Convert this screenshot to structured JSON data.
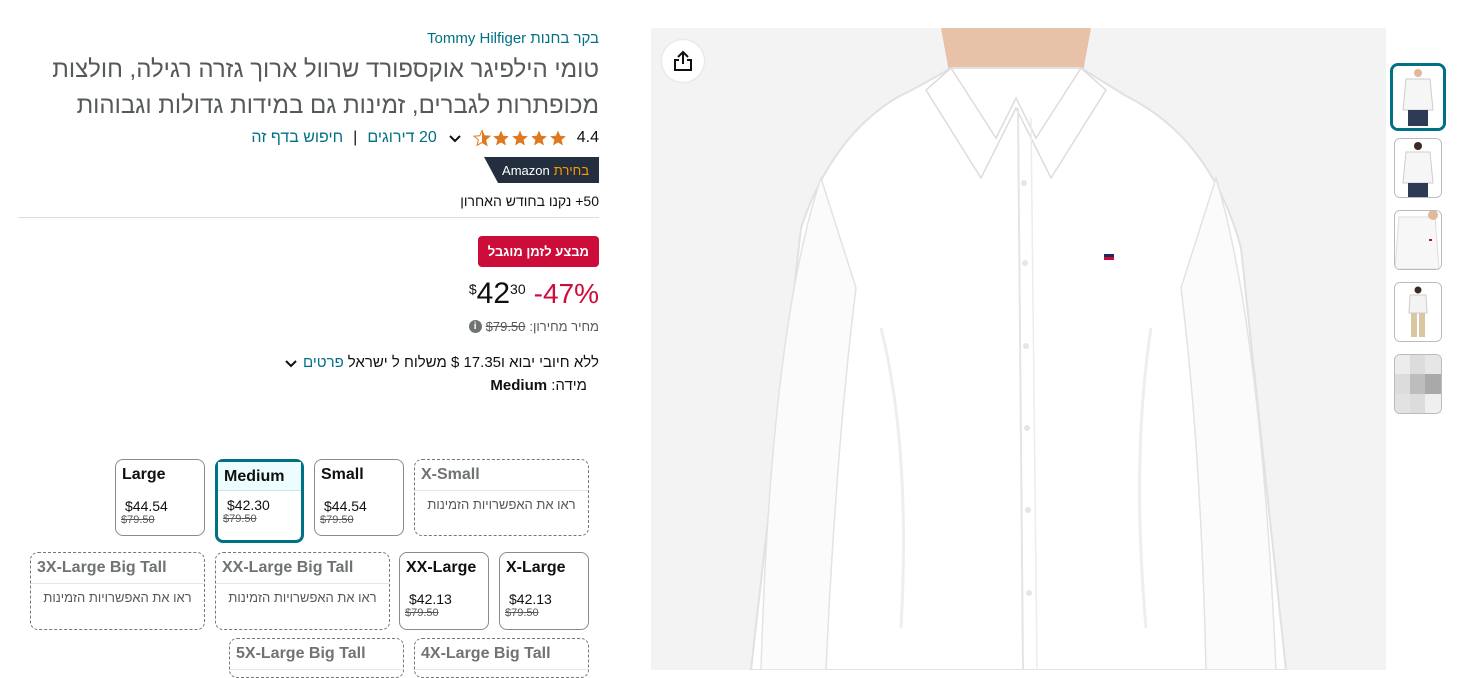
{
  "product": {
    "brand_line": "בקר בחנות Tommy Hilfiger",
    "title": "טומי הילפיגר אוקספורד שרוול ארוך גזרה רגילה, חולצות מכופתרות לגברים, זמינות גם במידות גדולות וגבוהות",
    "rating": "4.4",
    "ratings_count": "20 דירוגים",
    "search_page": "חיפוש בדף זה",
    "badge_choice": "בחירת",
    "badge_brand": "Amazon",
    "bought_past_month": "50+ נקנו בחודש האחרון"
  },
  "deal": {
    "badge": "מבצע לזמן מוגבל",
    "discount": "-47%",
    "currency": "$",
    "price_whole": "42",
    "price_fraction": "30",
    "list_price_label": "מחיר מחירון:",
    "list_price": "$79.50",
    "info_icon": "i"
  },
  "shipping": {
    "text": "ללא חיובי יבוא ו17.35 $ משלוח ל ישראל",
    "details_link": "פרטים"
  },
  "size": {
    "label": "מידה:",
    "selected": "Medium",
    "options": [
      {
        "name": "Large",
        "price": "$44.54",
        "list": "$79.50"
      },
      {
        "name": "Medium",
        "price": "$42.30",
        "list": "$79.50"
      },
      {
        "name": "Small",
        "price": "$44.54",
        "list": "$79.50"
      },
      {
        "name": "X-Small",
        "availability": "ראו את האפשרויות הזמינות"
      },
      {
        "name": "3X-Large Big Tall",
        "availability": "ראו את האפשרויות הזמינות"
      },
      {
        "name": "XX-Large Big Tall",
        "availability": "ראו את האפשרויות הזמינות"
      },
      {
        "name": "XX-Large",
        "price": "$42.13",
        "list": "$79.50"
      },
      {
        "name": "X-Large",
        "price": "$42.13",
        "list": "$79.50"
      },
      {
        "name": "5X-Large Big Tall"
      },
      {
        "name": "4X-Large Big Tall"
      }
    ]
  },
  "icons": {
    "share": "share-icon",
    "chevron": "chevron-down-icon",
    "star": "star-icon"
  },
  "colors": {
    "link": "#007185",
    "deal": "#cc0c39",
    "star": "#de7921",
    "choice_bg": "#232f3e",
    "choice_accent": "#ff9900"
  }
}
